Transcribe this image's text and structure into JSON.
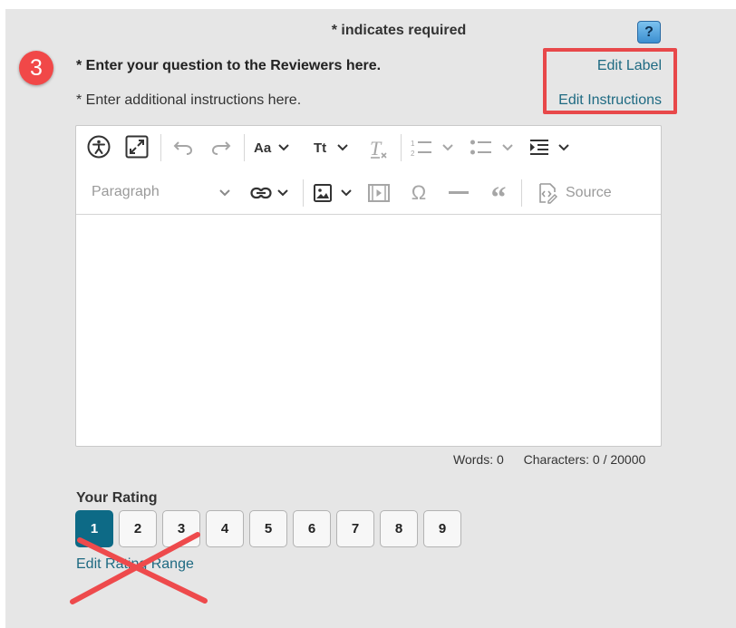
{
  "header": {
    "required_note": "* indicates required",
    "help_label": "?",
    "step_number": "3"
  },
  "question": {
    "label": "* Enter your question to the Reviewers here.",
    "instructions": "* Enter additional instructions here.",
    "edit_label_link": "Edit Label",
    "edit_instructions_link": "Edit Instructions"
  },
  "toolbar": {
    "row1": [
      "accessibility-icon",
      "fullscreen-icon",
      "undo-icon",
      "redo-icon",
      "font-family-icon",
      "font-size-icon",
      "remove-format-icon",
      "numbered-list-icon",
      "bulleted-list-icon",
      "indent-icon"
    ],
    "paragraph_label": "Paragraph",
    "row2": [
      "link-icon",
      "image-icon",
      "media-icon",
      "special-character-icon",
      "horizontal-line-icon",
      "blockquote-icon",
      "source-icon"
    ],
    "font_family_label": "Aa",
    "font_size_label": "Tt",
    "source_label": "Source"
  },
  "counts": {
    "words": "Words: 0",
    "characters": "Characters: 0 / 20000"
  },
  "rating": {
    "title": "Your Rating",
    "options": [
      "1",
      "2",
      "3",
      "4",
      "5",
      "6",
      "7",
      "8",
      "9"
    ],
    "selected": "1",
    "edit_range_link": "Edit Rating Range"
  },
  "annotations": {
    "highlight_color": "#e8484a",
    "cross_color": "#ee4a4c",
    "badge_color": "#f14848"
  }
}
